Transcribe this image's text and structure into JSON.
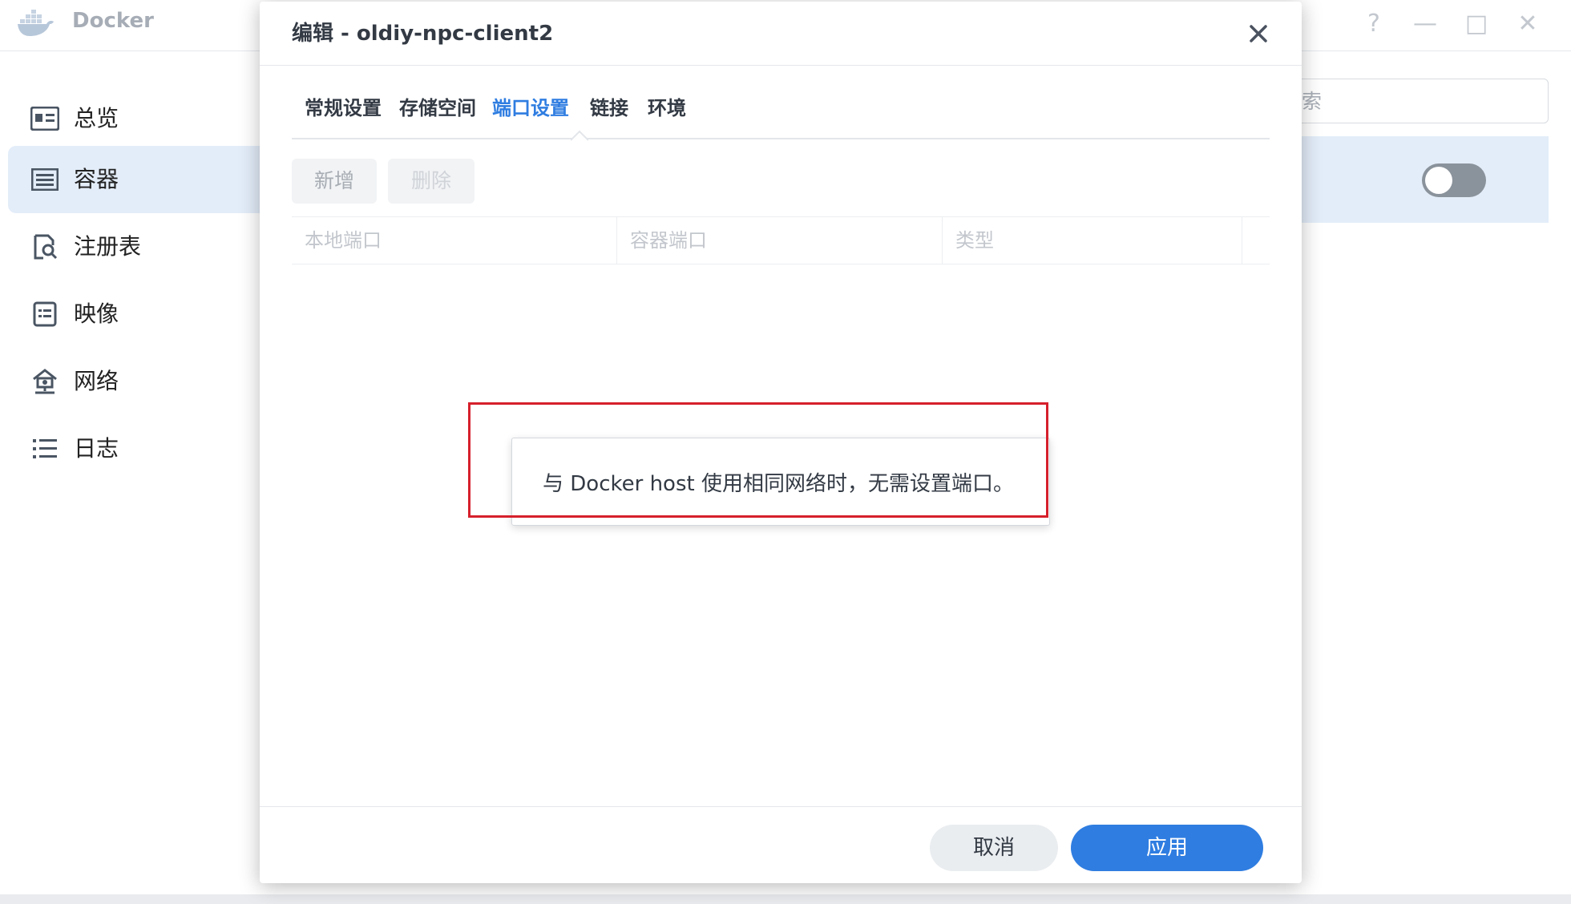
{
  "app": {
    "title": "Docker",
    "logo_icon": "docker-whale-icon",
    "window_controls": {
      "help": "?",
      "minimize": "—",
      "maximize": "□",
      "close": "✕"
    }
  },
  "sidebar": {
    "items": [
      {
        "label": "总览",
        "icon": "overview-card-icon",
        "active": false
      },
      {
        "label": "容器",
        "icon": "container-list-icon",
        "active": true
      },
      {
        "label": "注册表",
        "icon": "registry-search-icon",
        "active": false
      },
      {
        "label": "映像",
        "icon": "image-document-icon",
        "active": false
      },
      {
        "label": "网络",
        "icon": "network-house-icon",
        "active": false
      },
      {
        "label": "日志",
        "icon": "log-list-icon",
        "active": false
      }
    ]
  },
  "background": {
    "search_placeholder": "索",
    "toggle_state": "off"
  },
  "modal": {
    "title": "编辑 - oldiy-npc-client2",
    "tabs": [
      {
        "label": "常规设置",
        "active": false
      },
      {
        "label": "存储空间",
        "active": false
      },
      {
        "label": "端口设置",
        "active": true
      },
      {
        "label": "链接",
        "active": false
      },
      {
        "label": "环境",
        "active": false
      }
    ],
    "toolbar": {
      "add_label": "新增",
      "delete_label": "删除"
    },
    "columns": [
      "本地端口",
      "容器端口",
      "类型"
    ],
    "tooltip": "与 Docker host 使用相同网络时，无需设置端口。",
    "footer": {
      "cancel_label": "取消",
      "apply_label": "应用"
    }
  },
  "colors": {
    "accent": "#2f7de1",
    "selection": "#e3edf9",
    "highlight": "#d6202c"
  }
}
